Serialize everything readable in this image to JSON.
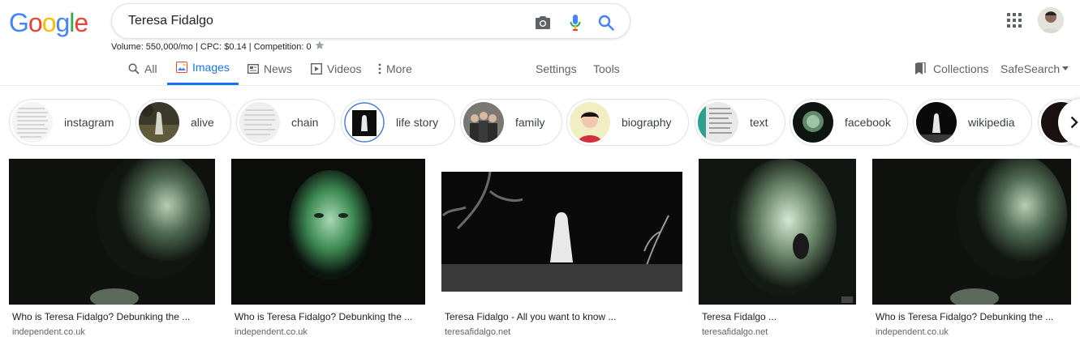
{
  "logo": {
    "text": "Google",
    "letters": [
      "G",
      "o",
      "o",
      "g",
      "l",
      "e"
    ],
    "colors": [
      "#4285f4",
      "#ea4335",
      "#fbbc05",
      "#4285f4",
      "#34a853",
      "#ea4335"
    ]
  },
  "search": {
    "query": "Teresa Fidalgo",
    "camera_icon": "camera-icon",
    "mic_icon": "microphone-icon",
    "search_icon": "search-icon"
  },
  "seo": {
    "text": "Volume: 550,000/mo | CPC: $0.14 | Competition: 0"
  },
  "tabs": [
    {
      "label": "All",
      "icon": "search-icon"
    },
    {
      "label": "Images",
      "icon": "image-icon"
    },
    {
      "label": "News",
      "icon": "news-icon"
    },
    {
      "label": "Videos",
      "icon": "play-icon"
    },
    {
      "label": "More",
      "icon": "more-vert-icon"
    }
  ],
  "tools": {
    "settings": "Settings",
    "tools": "Tools",
    "collections": "Collections",
    "safesearch": "SafeSearch"
  },
  "chips": [
    {
      "label": "instagram"
    },
    {
      "label": "alive"
    },
    {
      "label": "chain"
    },
    {
      "label": "life story"
    },
    {
      "label": "family"
    },
    {
      "label": "biography"
    },
    {
      "label": "text"
    },
    {
      "label": "facebook"
    },
    {
      "label": "wikipedia"
    }
  ],
  "results": [
    {
      "title": "Who is Teresa Fidalgo? Debunking the ...",
      "source": "independent.co.uk"
    },
    {
      "title": "Who is Teresa Fidalgo? Debunking the ...",
      "source": "independent.co.uk"
    },
    {
      "title": "Teresa Fidalgo - All you want to know ...",
      "source": "teresafidalgo.net"
    },
    {
      "title": "Teresa Fidalgo ...",
      "source": "teresafidalgo.net"
    },
    {
      "title": "Who is Teresa Fidalgo? Debunking the ...",
      "source": "independent.co.uk"
    }
  ],
  "colors": {
    "accent": "#1a73e8",
    "text": "#202124",
    "muted": "#5f6368",
    "border": "#dfe1e5"
  }
}
